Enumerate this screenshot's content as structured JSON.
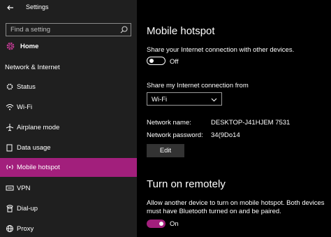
{
  "window": {
    "title": "Settings"
  },
  "sidebar": {
    "search_placeholder": "Find a setting",
    "home_label": "Home",
    "section_label": "Network & Internet",
    "items": [
      {
        "label": "Status",
        "icon": "status-icon"
      },
      {
        "label": "Wi-Fi",
        "icon": "wifi-icon"
      },
      {
        "label": "Airplane mode",
        "icon": "airplane-icon"
      },
      {
        "label": "Data usage",
        "icon": "data-usage-icon"
      },
      {
        "label": "Mobile hotspot",
        "icon": "hotspot-icon",
        "active": true
      },
      {
        "label": "VPN",
        "icon": "vpn-icon"
      },
      {
        "label": "Dial-up",
        "icon": "dialup-icon"
      },
      {
        "label": "Proxy",
        "icon": "proxy-icon"
      }
    ]
  },
  "main": {
    "title": "Mobile hotspot",
    "share_desc": "Share your Internet connection with other devices.",
    "share_toggle": {
      "state": "Off",
      "on": false
    },
    "share_from_label": "Share my Internet connection from",
    "share_from_value": "Wi-Fi",
    "network_name_label": "Network name:",
    "network_name_value": "DESKTOP-J41HJEM 7531",
    "network_password_label": "Network password:",
    "network_password_value": "34(9Do14",
    "edit_label": "Edit",
    "remote_title": "Turn on remotely",
    "remote_desc_line1": "Allow another device to turn on mobile hotspot. Both devices",
    "remote_desc_line2": "must have Bluetooth turned on and be paired.",
    "remote_toggle": {
      "state": "On",
      "on": true
    }
  },
  "colors": {
    "accent": "#a21f7c",
    "sidebar_bg": "#1f1f1f",
    "main_bg": "#000000"
  }
}
